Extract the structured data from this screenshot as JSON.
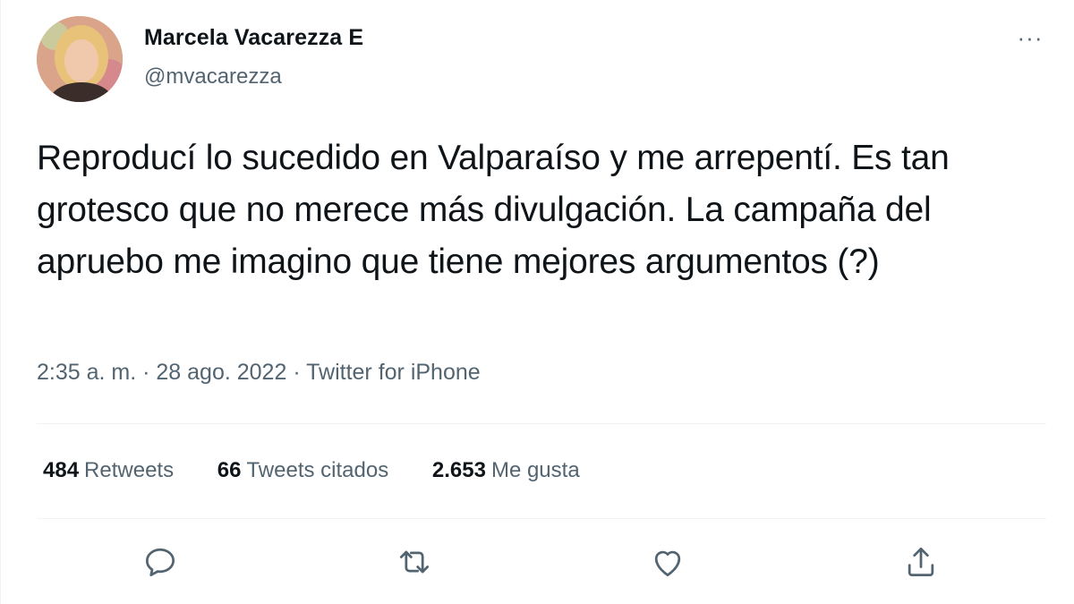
{
  "author": {
    "name": "Marcela Vacarezza E",
    "handle": "@mvacarezza",
    "avatar_icon": "avatar-photo"
  },
  "more_label": "···",
  "tweet": {
    "text": "Reproducí lo sucedido en Valparaíso y me arrepentí. Es tan grotesco que no merece más divulgación. La campaña del apruebo me imagino que tiene mejores argumentos (?)"
  },
  "meta": {
    "time": "2:35 a. m.",
    "sep1": " · ",
    "date": "28 ago. 2022",
    "sep2": " · ",
    "source": "Twitter for iPhone"
  },
  "stats": {
    "retweets_count": "484",
    "retweets_label": "Retweets",
    "quotes_count": "66",
    "quotes_label": "Tweets citados",
    "likes_count": "2.653",
    "likes_label": "Me gusta"
  },
  "actions": [
    {
      "icon": "reply-icon"
    },
    {
      "icon": "retweet-icon"
    },
    {
      "icon": "like-icon"
    },
    {
      "icon": "share-icon"
    }
  ],
  "colors": {
    "text_primary": "#0f1419",
    "text_secondary": "#536471",
    "divider": "#eff3f4"
  }
}
